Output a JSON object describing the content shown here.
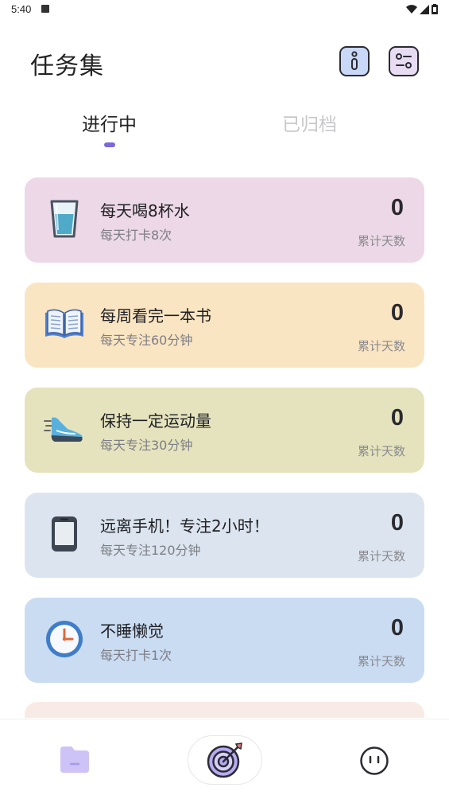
{
  "status_bar": {
    "time": "5:40"
  },
  "header": {
    "title": "任务集"
  },
  "tabs": [
    {
      "label": "进行中"
    },
    {
      "label": "已归档"
    }
  ],
  "tasks": [
    {
      "title": "每天喝8杯水",
      "subtitle": "每天打卡8次",
      "count": "0",
      "count_label": "累计天数",
      "color": "#ecd8e6",
      "icon": "water-glass-icon"
    },
    {
      "title": "每周看完一本书",
      "subtitle": "每天专注60分钟",
      "count": "0",
      "count_label": "累计天数",
      "color": "#fae5c2",
      "icon": "book-icon"
    },
    {
      "title": "保持一定运动量",
      "subtitle": "每天专注30分钟",
      "count": "0",
      "count_label": "累计天数",
      "color": "#e5e3bd",
      "icon": "running-shoe-icon"
    },
    {
      "title": "远离手机！专注2小时！",
      "subtitle": "每天专注120分钟",
      "count": "0",
      "count_label": "累计天数",
      "color": "#dce5ef",
      "icon": "phone-icon"
    },
    {
      "title": "不睡懒觉",
      "subtitle": "每天打卡1次",
      "count": "0",
      "count_label": "累计天数",
      "color": "#cadcf2",
      "icon": "clock-icon"
    }
  ],
  "partial_card": {
    "color": "#f8ebe6"
  },
  "bottom_nav": [
    {
      "icon": "folder-icon"
    },
    {
      "icon": "target-icon"
    },
    {
      "icon": "face-icon"
    }
  ]
}
